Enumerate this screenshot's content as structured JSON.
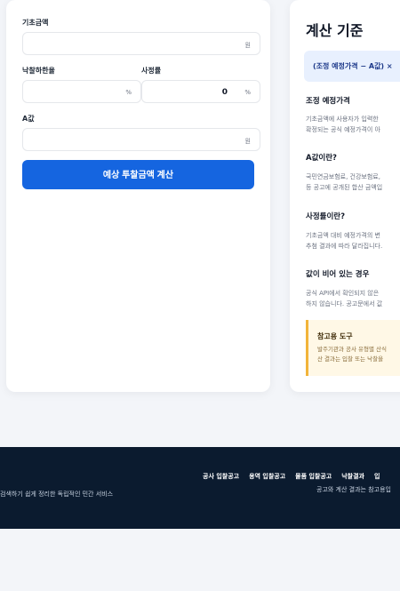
{
  "calculator": {
    "base_amount": {
      "label": "기초금액",
      "value": "",
      "unit": "원"
    },
    "bid_rate": {
      "label": "낙찰하한율",
      "value": "",
      "unit": "%"
    },
    "assessment_rate": {
      "label": "사정률",
      "value": "0",
      "unit": "%"
    },
    "a_value": {
      "label": "A값",
      "value": "",
      "unit": "원"
    },
    "submit_label": "예상 투찰금액 계산"
  },
  "criteria": {
    "title": "계산 기준",
    "formula": "(조정 예정가격 − A값) × ",
    "sections": [
      {
        "heading": "조정 예정가격",
        "lines": [
          "기초금액에 사용자가 입력한 ",
          "확정되는 공식 예정가격이 아"
        ]
      },
      {
        "heading": "A값이란?",
        "lines": [
          "국민연금보험료, 건강보험료, ",
          "등 공고에 공개된 합산 금액입"
        ]
      },
      {
        "heading": "사정률이란?",
        "lines": [
          "기초금액 대비 예정가격의 변",
          "추첨 결과에 따라 달라집니다."
        ]
      },
      {
        "heading": "값이 비어 있는 경우",
        "lines": [
          "공식 API에서 확인되지 않은 ",
          "하지 않습니다. 공고문에서 값"
        ]
      }
    ],
    "note": {
      "heading": "참고용 도구",
      "lines": [
        "발주기관과 공사 유형별 산식",
        "산 결과는 입찰 또는 낙찰을 "
      ]
    }
  },
  "footer": {
    "tagline": "검색하기 쉽게 정리한 독립적인 민간 서비스",
    "links": [
      "공사 입찰공고",
      "용역 입찰공고",
      "물품 입찰공고",
      "낙찰결과",
      "입"
    ],
    "note": "공고와 계산 결과는 참고용입"
  },
  "colors": {
    "primary": "#1565e0",
    "formula_bg": "#e8f0fe",
    "note_bg": "#fff8e6",
    "note_border": "#f2b43a",
    "footer_bg": "#0b1b2f"
  }
}
